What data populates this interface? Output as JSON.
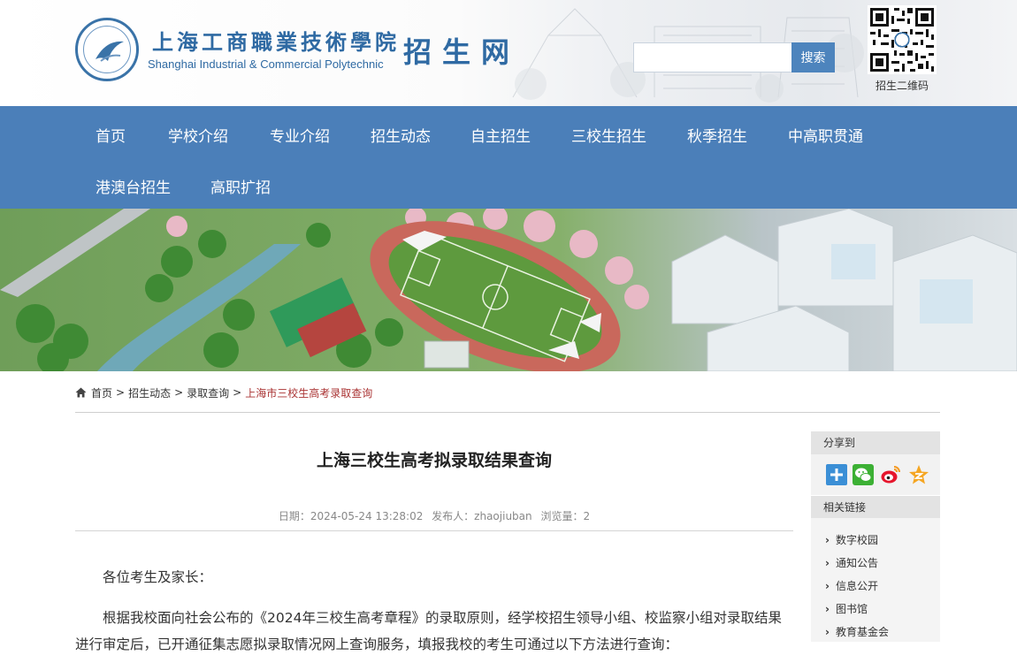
{
  "header": {
    "school_name_cn": "上海工商職業技術學院",
    "school_name_en": "Shanghai Industrial & Commercial Polytechnic",
    "site_name": "招生网",
    "search_placeholder": "",
    "search_button": "搜索",
    "qr_label": "招生二维码"
  },
  "nav": {
    "items": [
      {
        "label": "首页"
      },
      {
        "label": "学校介绍"
      },
      {
        "label": "专业介绍"
      },
      {
        "label": "招生动态"
      },
      {
        "label": "自主招生"
      },
      {
        "label": "三校生招生"
      },
      {
        "label": "秋季招生"
      },
      {
        "label": "中高职贯通"
      },
      {
        "label": "港澳台招生"
      },
      {
        "label": "高职扩招"
      }
    ]
  },
  "breadcrumb": {
    "items": [
      "首页",
      "招生动态",
      "录取查询"
    ],
    "current": "上海市三校生高考录取查询",
    "separator": ">"
  },
  "article": {
    "title": "上海三校生高考拟录取结果查询",
    "date": "日期：2024-05-24 13:28:02",
    "author": "发布人：zhaojiuban",
    "views": "浏览量：2",
    "greeting": "各位考生及家长：",
    "paragraph": "根据我校面向社会公布的《2024年三校生高考章程》的录取原则，经学校招生领导小组、校监察小组对录取结果进行审定后，已开通征集志愿拟录取情况网上查询服务，填报我校的考生可通过以下方法进行查询："
  },
  "sidebar": {
    "share_title": "分享到",
    "share_icons": [
      "share-more-icon",
      "wechat-icon",
      "weibo-icon",
      "qzone-icon"
    ],
    "links_title": "相关链接",
    "links": [
      "数字校园",
      "通知公告",
      "信息公开",
      "图书馆",
      "教育基金会"
    ]
  },
  "colors": {
    "nav_bg": "#4b7fb9",
    "brand_blue": "#2f6aa3",
    "search_button": "#4d84bd",
    "breadcrumb_current": "#aa3333"
  }
}
